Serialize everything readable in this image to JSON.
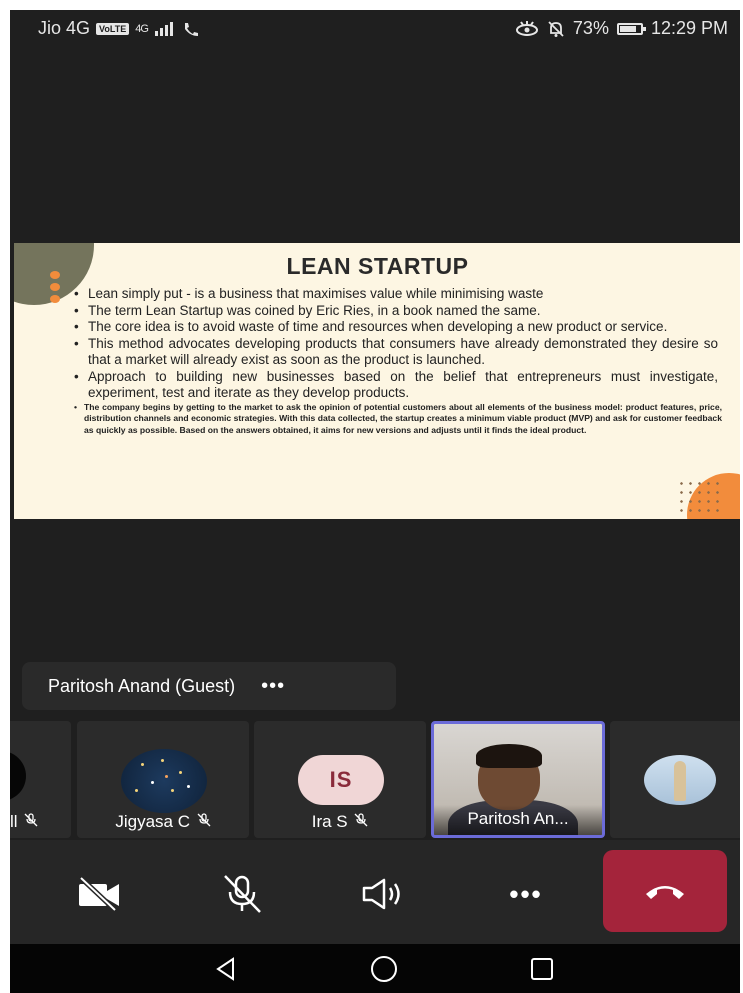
{
  "status_bar": {
    "carrier": "Jio 4G",
    "volte": "VoLTE",
    "network": "4G",
    "battery_percent_label": "73%",
    "battery_level": 0.73,
    "time": "12:29 PM"
  },
  "slide": {
    "title": "LEAN STARTUP",
    "bullets": [
      "Lean simply put - is a business that maximises value while minimising waste",
      "The term Lean Startup was coined by Eric Ries, in a book named the same.",
      "The core idea is to avoid waste of time and resources when developing a new product or service.",
      "This method advocates developing products that consumers have already demonstrated they desire so that a market will already exist as soon as the product is launched.",
      "Approach to building new businesses based on the belief that entrepreneurs must investigate, experiment, test and iterate as they develop products."
    ],
    "small_bullet": "The company begins by getting to the market to ask the opinion of potential customers about all elements of the business model: product features, price, distribution channels and economic strategies. With this data collected, the startup creates a minimum viable product (MVP) and ask for customer feedback as quickly as possible. Based on the answers obtained, it aims for new versions and adjusts until it finds the ideal product."
  },
  "presenter": {
    "name": "Paritosh Anand (Guest)",
    "more": "•••"
  },
  "participants": [
    {
      "label": "ll",
      "muted": true
    },
    {
      "label": "Jigyasa C",
      "muted": true
    },
    {
      "label": "Ira S",
      "initials": "IS",
      "muted": true
    },
    {
      "label": "Paritosh An...",
      "active": true
    },
    {
      "label": ""
    }
  ],
  "controls": {
    "more": "•••"
  },
  "colors": {
    "end_call": "#a4243b",
    "active_border": "#6b6bd8",
    "slide_bg": "#fdf6e3",
    "accent_orange": "#f28c3c"
  }
}
